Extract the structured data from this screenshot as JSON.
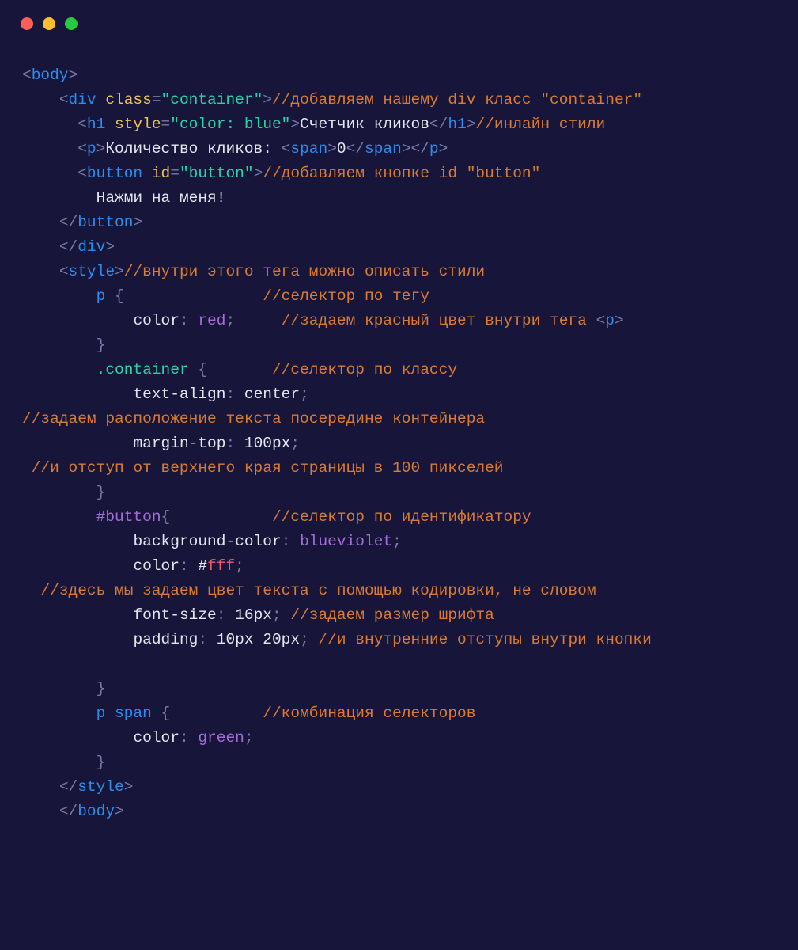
{
  "window": {
    "dots": [
      "red",
      "yellow",
      "green"
    ]
  },
  "code": {
    "l1": {
      "tag": "body"
    },
    "l2": {
      "tag": "div",
      "attr": "class",
      "val": "\"container\"",
      "comment": "//добавляем нашему div класс \"container\""
    },
    "l3": {
      "tag": "h1",
      "attr": "style",
      "val": "\"color: blue\"",
      "text": "Счетчик кликов",
      "comment": "//инлайн стили"
    },
    "l4": {
      "tag": "p",
      "text1": "Количество кликов: ",
      "tag2": "span",
      "zero": "0"
    },
    "l5": {
      "tag": "button",
      "attr": "id",
      "val": "\"button\"",
      "comment": "//добавляем кнопке id \"button\""
    },
    "l6": {
      "text": "Нажми на меня!"
    },
    "l7": {
      "tag": "button"
    },
    "l8": {
      "tag": "div"
    },
    "l9": {
      "tag": "style",
      "comment": "//внутри этого тега можно описать стили"
    },
    "l10": {
      "sel": "p",
      "comment": "//селектор по тегу"
    },
    "l11": {
      "prop": "color",
      "val": "red",
      "comment": "//задаем красный цвет внутри тега ",
      "tagref": "p"
    },
    "l12": {},
    "l13": {
      "sel": ".container",
      "comment": "//селектор по классу"
    },
    "l14": {
      "prop": "text-align",
      "val": "center"
    },
    "l15": {
      "comment": "//задаем расположение текста посередине контейнера"
    },
    "l16": {
      "prop": "margin-top",
      "val": "100px"
    },
    "l17": {
      "comment": " //и отступ от верхнего края страницы в 100 пикселей"
    },
    "l18": {},
    "l19": {
      "sel": "#button",
      "comment": "//селектор по идентификатору"
    },
    "l20": {
      "prop": "background-color",
      "val": "blueviolet"
    },
    "l21": {
      "prop": "color",
      "hash": "#",
      "hex": "fff"
    },
    "l22": {
      "comment": "  //здесь мы задаем цвет текста с помощью кодировки, не словом"
    },
    "l23": {
      "prop": "font-size",
      "val": "16px",
      "comment": "//задаем размер шрифта"
    },
    "l24": {
      "prop": "padding",
      "val": "10px 20px",
      "comment": "//и внутренние отступы внутри кнопки"
    },
    "l25": {},
    "l26": {},
    "l27": {
      "sel1": "p",
      "sel2": "span",
      "comment": "//комбинация селекторов"
    },
    "l28": {
      "prop": "color",
      "val": "green"
    },
    "l29": {},
    "l30": {
      "tag": "style"
    },
    "l31": {
      "tag": "body"
    }
  }
}
